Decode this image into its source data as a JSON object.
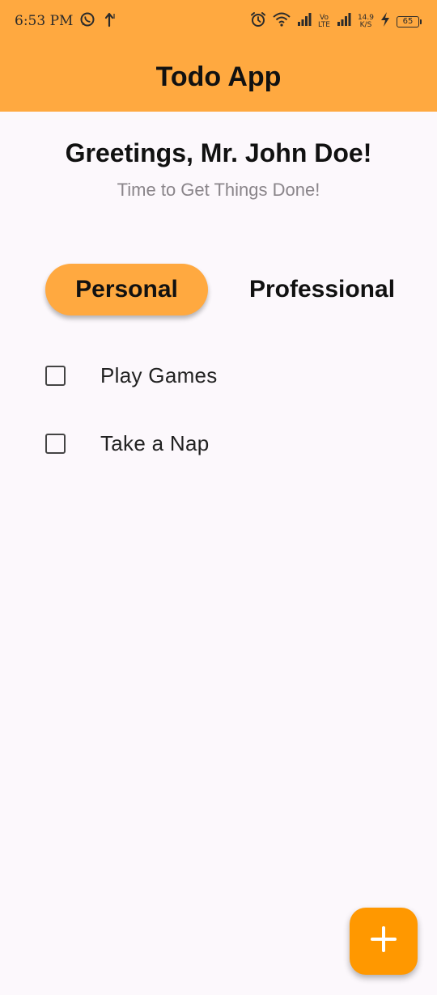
{
  "status_bar": {
    "time": "6:53 PM",
    "network_volte_top": "Vo",
    "network_volte_bottom": "LTE",
    "speed_value": "14.9",
    "speed_unit": "K/S",
    "battery_level": "65",
    "icons": [
      "whatsapp-icon",
      "upload-arrow-icon",
      "alarm-icon",
      "wifi-icon",
      "signal-icon",
      "signal-icon",
      "charging-icon",
      "battery-icon"
    ]
  },
  "app_bar": {
    "title": "Todo App"
  },
  "greeting": {
    "title": "Greetings, Mr. John Doe!",
    "subtitle": "Time to Get Things Done!"
  },
  "tabs": [
    {
      "label": "Personal",
      "selected": true
    },
    {
      "label": "Professional",
      "selected": false
    }
  ],
  "todos": [
    {
      "label": "Play Games",
      "checked": false
    },
    {
      "label": "Take a Nap",
      "checked": false
    }
  ],
  "fab": {
    "icon": "plus-icon"
  },
  "colors": {
    "accent": "#ffa940",
    "fab": "#ff9800",
    "background": "#fcf8fc",
    "subtitle": "#8a858a"
  }
}
